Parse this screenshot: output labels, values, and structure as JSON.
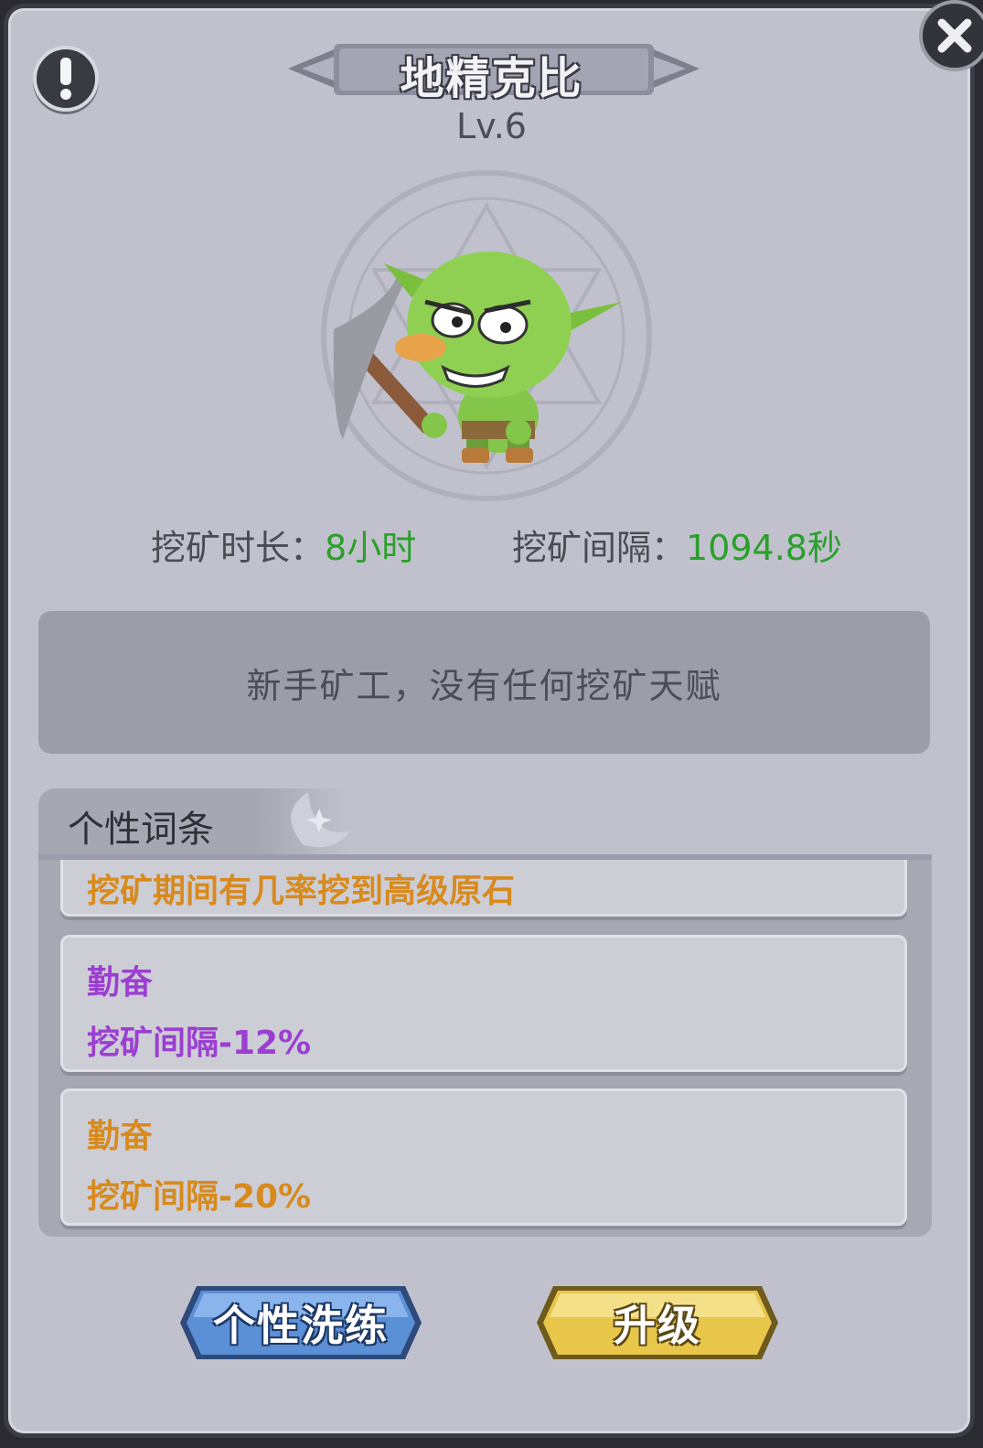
{
  "header": {
    "title": "地精克比",
    "level": "Lv.6"
  },
  "stats": {
    "duration_label": "挖矿时长：",
    "duration_value": "8小时",
    "interval_label": "挖矿间隔：",
    "interval_value": "1094.8秒"
  },
  "description": "新手矿工，没有任何挖矿天赋",
  "traits": {
    "tab_label": "个性词条",
    "items": [
      {
        "name": "",
        "effect": "挖矿期间有几率挖到高级原石",
        "color": "#d88a1c"
      },
      {
        "name": "勤奋",
        "effect": "挖矿间隔-12%",
        "color": "#9b3fd0"
      },
      {
        "name": "勤奋",
        "effect": "挖矿间隔-20%",
        "color": "#d88a1c"
      }
    ]
  },
  "buttons": {
    "reroll_label": "个性洗练",
    "upgrade_label": "升级"
  },
  "icons": {
    "info": "exclamation-icon",
    "close": "close-icon",
    "portrait": "goblin-miner-portrait"
  },
  "colors": {
    "accent_green": "#2aa02a",
    "orange": "#d88a1c",
    "purple": "#9b3fd0",
    "reroll_blue": "#5b8fd6",
    "upgrade_gold": "#e8c64a"
  }
}
